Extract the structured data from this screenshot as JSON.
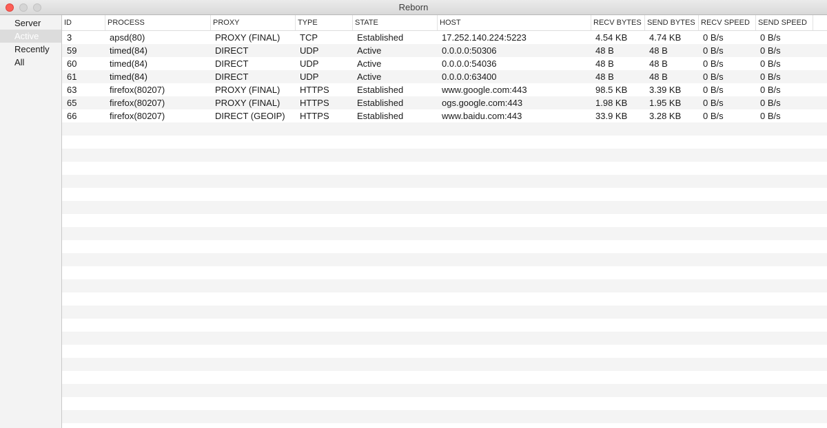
{
  "window": {
    "title": "Reborn"
  },
  "sidebar": {
    "items": [
      {
        "label": "Server"
      },
      {
        "label": "Active"
      },
      {
        "label": "Recently"
      },
      {
        "label": "All"
      }
    ]
  },
  "table": {
    "columns": [
      "ID",
      "PROCESS",
      "PROXY",
      "TYPE",
      "STATE",
      "HOST",
      "RECV BYTES",
      "SEND BYTES",
      "RECV SPEED",
      "SEND SPEED"
    ],
    "rows": [
      [
        "3",
        "apsd(80)",
        "PROXY (FINAL)",
        "TCP",
        "Established",
        "17.252.140.224:5223",
        "4.54 KB",
        "4.74 KB",
        "0 B/s",
        "0 B/s"
      ],
      [
        "59",
        "timed(84)",
        "DIRECT",
        "UDP",
        "Active",
        "0.0.0.0:50306",
        "48 B",
        "48 B",
        "0 B/s",
        "0 B/s"
      ],
      [
        "60",
        "timed(84)",
        "DIRECT",
        "UDP",
        "Active",
        "0.0.0.0:54036",
        "48 B",
        "48 B",
        "0 B/s",
        "0 B/s"
      ],
      [
        "61",
        "timed(84)",
        "DIRECT",
        "UDP",
        "Active",
        "0.0.0.0:63400",
        "48 B",
        "48 B",
        "0 B/s",
        "0 B/s"
      ],
      [
        "63",
        "firefox(80207)",
        "PROXY (FINAL)",
        "HTTPS",
        "Established",
        "www.google.com:443",
        "98.5 KB",
        "3.39 KB",
        "0 B/s",
        "0 B/s"
      ],
      [
        "65",
        "firefox(80207)",
        "PROXY (FINAL)",
        "HTTPS",
        "Established",
        "ogs.google.com:443",
        "1.98 KB",
        "1.95 KB",
        "0 B/s",
        "0 B/s"
      ],
      [
        "66",
        "firefox(80207)",
        "DIRECT (GEOIP)",
        "HTTPS",
        "Established",
        "www.baidu.com:443",
        "33.9 KB",
        "3.28 KB",
        "0 B/s",
        "0 B/s"
      ]
    ]
  },
  "colors": {
    "close_button": "#fc5f57",
    "inactive_button": "#d5d5d5",
    "selection": "#dcdcdc",
    "alt_row": "#f4f4f4"
  },
  "icons": [
    "close-button-icon",
    "minimize-button-icon",
    "zoom-button-icon"
  ]
}
